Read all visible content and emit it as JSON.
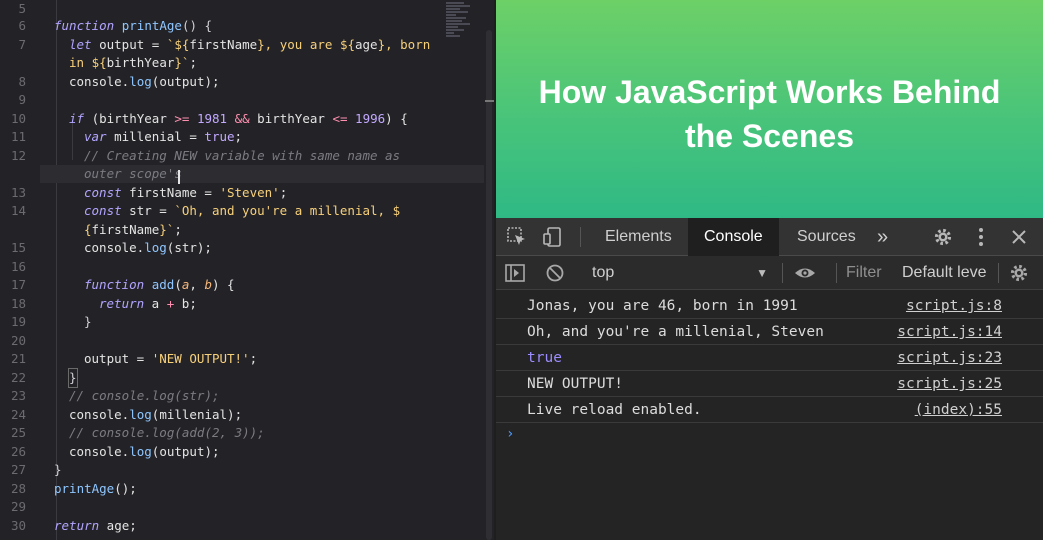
{
  "editor": {
    "line_numbers": [
      "5",
      "6",
      "7",
      "",
      "8",
      "9",
      "10",
      "11",
      "12",
      "",
      "13",
      "14",
      "",
      "15",
      "16",
      "17",
      "18",
      "19",
      "20",
      "21",
      "22",
      "23",
      "24",
      "25",
      "26",
      "27",
      "28",
      "29",
      "30"
    ],
    "code": {
      "l6_kw": "function",
      "l6_fn": "printAge",
      "l6_rest": "() {",
      "l7_kw": "let",
      "l7_a": " output = ",
      "l7_s1": "`${",
      "l7_v1": "firstName",
      "l7_s2": "}, you are ${",
      "l7_v2": "age",
      "l7_s3": "}, born",
      "l7b_s1": "in ${",
      "l7b_v1": "birthYear",
      "l7b_s2": "}`",
      "l7b_rest": ";",
      "l8_a": "console.",
      "l8_fn": "log",
      "l8_rest": "(output);",
      "l10_kw": "if",
      "l10_a": " (birthYear ",
      "l10_op1": ">=",
      "l10_n1": " 1981",
      "l10_op2": " &&",
      "l10_b": " birthYear ",
      "l10_op3": "<=",
      "l10_n2": " 1996",
      "l10_rest": ") {",
      "l11_kw": "var",
      "l11_a": " millenial = ",
      "l11_v": "true",
      "l11_rest": ";",
      "l12": "// Creating NEW variable with same name as",
      "l12b": "outer scope's",
      "l13_kw": "const",
      "l13_a": " firstName = ",
      "l13_s": "'Steven'",
      "l13_rest": ";",
      "l14_kw": "const",
      "l14_a": " str = ",
      "l14_s": "`Oh, and you're a millenial, $",
      "l14b_s1": "{",
      "l14b_v": "firstName",
      "l14b_s2": "}`",
      "l14b_rest": ";",
      "l15_a": "console.",
      "l15_fn": "log",
      "l15_rest": "(str);",
      "l17_kw": "function",
      "l17_fn": " add",
      "l17_a": "(",
      "l17_p1": "a",
      "l17_c": ", ",
      "l17_p2": "b",
      "l17_rest": ") {",
      "l18_kw": "return",
      "l18_a": " a ",
      "l18_op": "+",
      "l18_rest": " b;",
      "l19": "}",
      "l21_a": "output = ",
      "l21_s": "'NEW OUTPUT!'",
      "l21_rest": ";",
      "l22": "}",
      "l23": "// console.log(str);",
      "l24_a": "console.",
      "l24_fn": "log",
      "l24_rest": "(millenial);",
      "l25": "// console.log(add(2, 3));",
      "l26_a": "console.",
      "l26_fn": "log",
      "l26_rest": "(output);",
      "l27": "}",
      "l28_fn": "printAge",
      "l28_rest": "();",
      "l30_kw": "return",
      "l30_rest": " age;"
    }
  },
  "slide": {
    "title_line1": "How JavaScript Works Behind",
    "title_line2": "the Scenes",
    "colors": {
      "top": "#6dd067",
      "bottom": "#2fb985"
    }
  },
  "devtools": {
    "icons": {
      "inspect": "inspect-element-icon",
      "device": "device-toolbar-icon",
      "more_tabs": "more-tabs-icon",
      "settings": "gear-icon",
      "menu": "kebab-menu-icon",
      "close": "close-icon",
      "sidebar": "console-sidebar-icon",
      "clear": "clear-console-icon",
      "live_expression": "eye-icon"
    },
    "tabs": [
      {
        "label": "Elements",
        "active": false
      },
      {
        "label": "Console",
        "active": true
      },
      {
        "label": "Sources",
        "active": false
      }
    ],
    "more_tabs_glyph": "»",
    "filter_bar": {
      "context": "top",
      "filter_placeholder": "Filter",
      "levels": "Default levels"
    },
    "messages": [
      {
        "text": "Jonas, you are 46, born in 1991",
        "source": "script.js:8"
      },
      {
        "text": "Oh, and you're a millenial, Steven",
        "source": "script.js:14"
      },
      {
        "text": "true",
        "source": "script.js:23"
      },
      {
        "text": "NEW OUTPUT!",
        "source": "script.js:25"
      },
      {
        "text": "Live reload enabled.",
        "source": "(index):55"
      }
    ],
    "prompt_glyph": "›",
    "colors": {
      "boolean": "#9b8cff",
      "prompt": "#4f9cff",
      "active_tab_bg": "#1f1f1f"
    }
  }
}
